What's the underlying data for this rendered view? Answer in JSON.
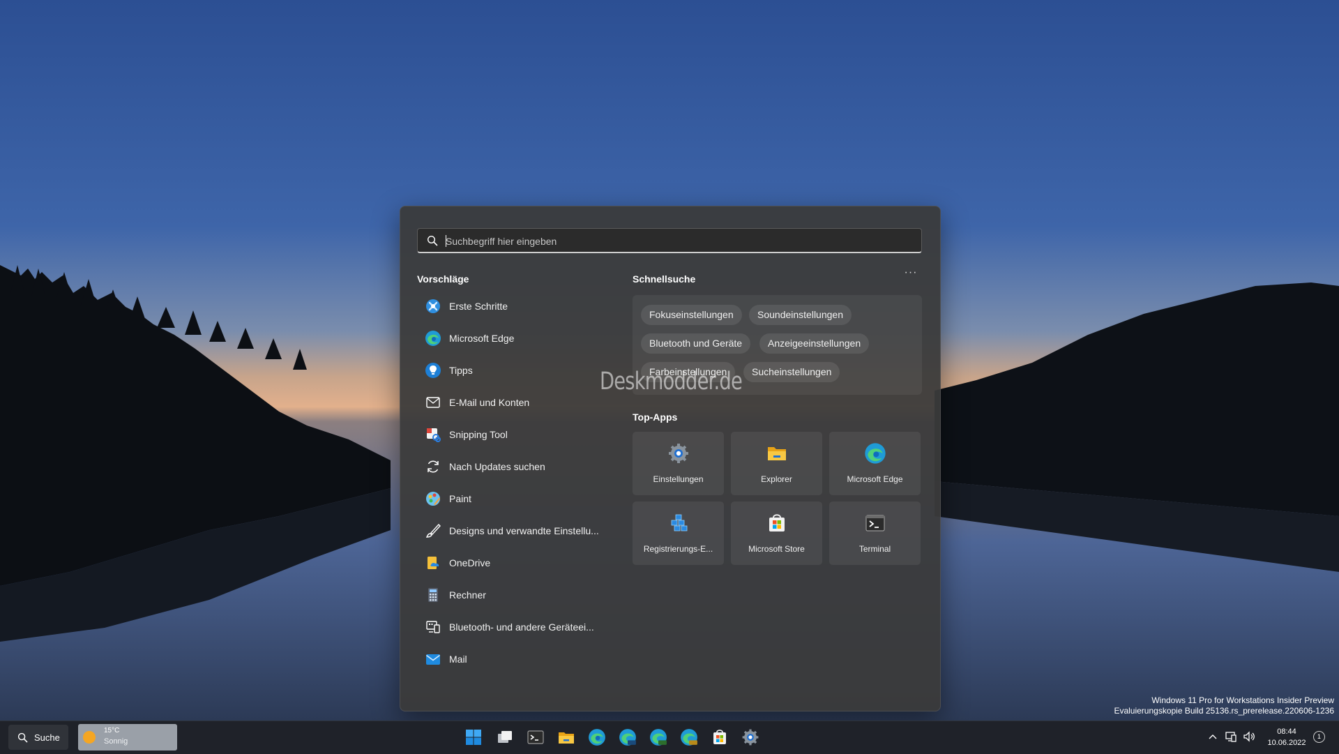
{
  "search": {
    "placeholder": "Suchbegriff hier eingeben"
  },
  "suggestions": {
    "title": "Vorschläge",
    "items": [
      {
        "label": "Erste Schritte",
        "icon": "get-started-icon"
      },
      {
        "label": "Microsoft Edge",
        "icon": "edge-icon"
      },
      {
        "label": "Tipps",
        "icon": "tips-icon"
      },
      {
        "label": "E-Mail und Konten",
        "icon": "mail-outline-icon"
      },
      {
        "label": "Snipping Tool",
        "icon": "snipping-tool-icon"
      },
      {
        "label": "Nach Updates suchen",
        "icon": "refresh-icon"
      },
      {
        "label": "Paint",
        "icon": "paint-icon"
      },
      {
        "label": "Designs und verwandte Einstellu...",
        "icon": "brush-icon"
      },
      {
        "label": "OneDrive",
        "icon": "onedrive-icon"
      },
      {
        "label": "Rechner",
        "icon": "calculator-icon"
      },
      {
        "label": "Bluetooth- und andere Geräteei...",
        "icon": "devices-icon"
      },
      {
        "label": "Mail",
        "icon": "mail-app-icon"
      }
    ]
  },
  "quick_search": {
    "title": "Schnellsuche",
    "more_label": "···",
    "chips": [
      "Fokuseinstellungen",
      "Soundeinstellungen",
      "Bluetooth und Geräte",
      "Anzeigeeinstellungen",
      "Farbeinstellungen",
      "Sucheinstellungen"
    ]
  },
  "top_apps": {
    "title": "Top-Apps",
    "tiles": [
      {
        "label": "Einstellungen",
        "icon": "settings-icon"
      },
      {
        "label": "Explorer",
        "icon": "folder-icon"
      },
      {
        "label": "Microsoft Edge",
        "icon": "edge-icon"
      },
      {
        "label": "Registrierungs-E...",
        "icon": "registry-editor-icon"
      },
      {
        "label": "Microsoft Store",
        "icon": "store-icon"
      },
      {
        "label": "Terminal",
        "icon": "terminal-icon"
      }
    ]
  },
  "watermark": "Deskmodder.de",
  "build_info": {
    "line1": "Windows 11 Pro for Workstations Insider Preview",
    "line2": "Evaluierungskopie Build 25136.rs_prerelease.220606-1236"
  },
  "taskbar": {
    "search_label": "Suche",
    "weather_temp": "15°C",
    "weather_condition": "Sonnig",
    "time": "08:44",
    "date": "10.06.2022",
    "notification_count": "1",
    "pinned": [
      "start-icon",
      "task-view-icon",
      "terminal-icon",
      "file-explorer-icon",
      "edge-icon",
      "edge-beta-icon",
      "edge-dev-icon",
      "edge-canary-icon",
      "store-icon",
      "settings-icon"
    ]
  },
  "colors": {
    "accent": "#0a84ff",
    "panel": "#3a3a3a",
    "taskbar": "#1f2229"
  }
}
